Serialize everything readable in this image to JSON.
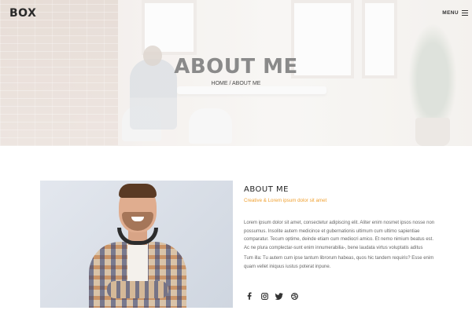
{
  "header": {
    "brand": "BOX",
    "menu_label": "MENU",
    "menu_icon": "hamburger-icon"
  },
  "hero": {
    "title": "ABOUT ME",
    "breadcrumb": {
      "home": "HOME",
      "separator": "/",
      "current": "ABOUT ME"
    }
  },
  "about": {
    "heading": "ABOUT ME",
    "subheading": "Creative & Lorem ipsum dolor sit amet",
    "paragraph_1": "Lorem ipsum dolor sit amet, consectetur adipiscing elit. Aliter enim nosmet ipsos nosse non possumus. Insolite autem medicince et gubernationis ultimum cum ultimo sapientiae comparatur. Tecum optime, deinde etiam cum mediocri amico. Et nemo nimium beatus est. Ac ne plura complectar-sunt enim innumerabilia-, bene laudata virtus voluptatis aditus",
    "paragraph_2": "Tum illa: Tu autem cum ipse tantum librorum habeas, quos hic tandem requiris? Esse enim quam vellet iniquus iustus poterat inpune."
  },
  "social": [
    {
      "name": "facebook",
      "icon": "facebook-icon"
    },
    {
      "name": "instagram",
      "icon": "instagram-icon"
    },
    {
      "name": "twitter",
      "icon": "twitter-icon"
    },
    {
      "name": "dribbble",
      "icon": "dribbble-icon"
    }
  ],
  "colors": {
    "accent": "#f0a030",
    "text_dark": "#222222",
    "text_body": "#666666",
    "hero_title": "#8a8a8a"
  }
}
